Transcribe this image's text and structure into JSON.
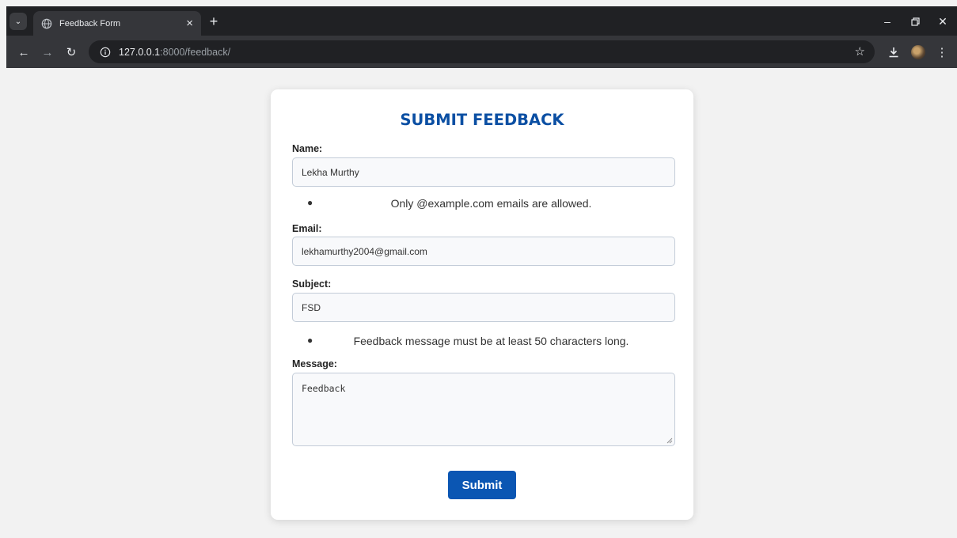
{
  "browser": {
    "tab_title": "Feedback Form",
    "url_host": "127.0.0.1",
    "url_path": ":8000/feedback/"
  },
  "form": {
    "title": "SUBMIT FEEDBACK",
    "name_label": "Name:",
    "name_value": "Lekha Murthy",
    "email_error": "Only @example.com emails are allowed.",
    "email_label": "Email:",
    "email_value": "lekhamurthy2004@gmail.com",
    "subject_label": "Subject:",
    "subject_value": "FSD",
    "message_error": "Feedback message must be at least 50 characters long.",
    "message_label": "Message:",
    "message_value": "Feedback",
    "submit_label": "Submit"
  },
  "colors": {
    "accent": "#0b4fa3",
    "button": "#0b56b3",
    "chrome_dark": "#202124",
    "chrome_toolbar": "#35363a"
  }
}
